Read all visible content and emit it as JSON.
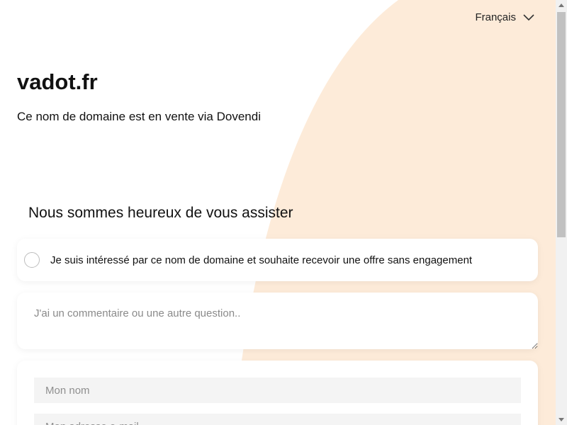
{
  "colors": {
    "accent_background": "#fdebd9",
    "card_background": "#ffffff",
    "input_background": "#f4f4f4"
  },
  "header": {
    "language": {
      "label": "Français",
      "icon": "chevron-down-icon"
    }
  },
  "hero": {
    "domain": "vadot.fr",
    "subtitle": "Ce nom de domaine est en vente via Dovendi"
  },
  "form": {
    "heading": "Nous sommes heureux de vous assister",
    "interest_option": {
      "label": "Je suis intéressé par ce nom de domaine et souhaite recevoir une offre sans engagement",
      "selected": false
    },
    "comment": {
      "placeholder": "J'ai un commentaire ou une autre question..",
      "value": ""
    },
    "name_field": {
      "placeholder": "Mon nom",
      "value": ""
    },
    "email_field": {
      "placeholder": "Mon adresse e-mail",
      "value": ""
    }
  }
}
